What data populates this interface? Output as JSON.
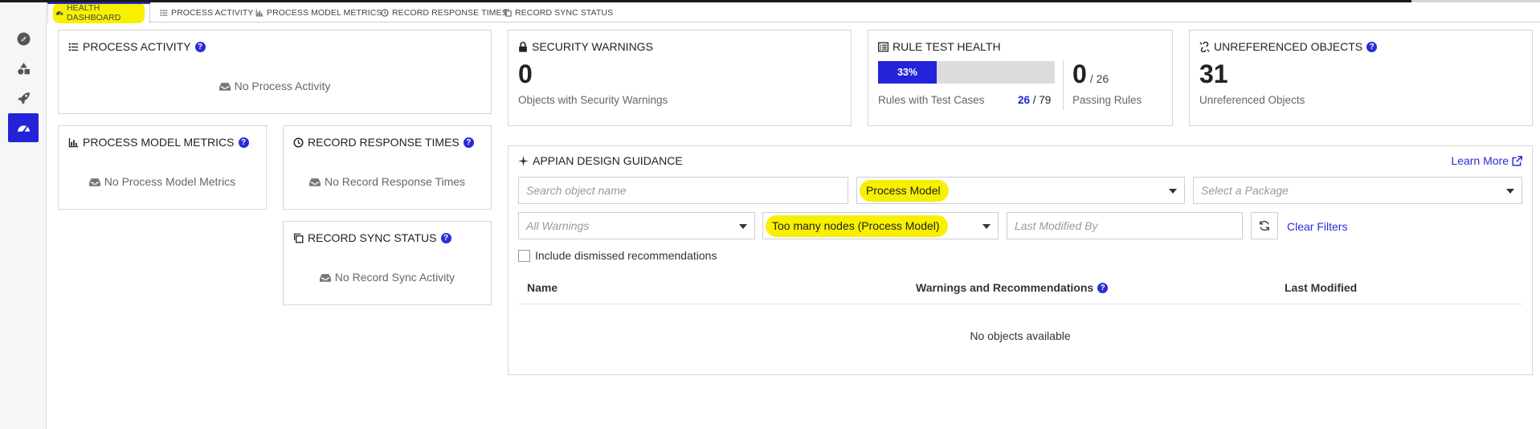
{
  "tabs": [
    {
      "label": "HEALTH DASHBOARD",
      "icon": "dashboard-icon"
    },
    {
      "label": "PROCESS ACTIVITY",
      "icon": "list-icon"
    },
    {
      "label": "PROCESS MODEL METRICS",
      "icon": "bar-chart-icon"
    },
    {
      "label": "RECORD RESPONSE TIMES",
      "icon": "clock-icon"
    },
    {
      "label": "RECORD SYNC STATUS",
      "icon": "copy-icon"
    }
  ],
  "sidebar": {
    "items": [
      {
        "icon": "compass-icon"
      },
      {
        "icon": "shapes-icon"
      },
      {
        "icon": "rocket-icon"
      },
      {
        "icon": "dashboard-icon",
        "active": true
      }
    ]
  },
  "process_activity": {
    "title": "PROCESS ACTIVITY",
    "empty": "No Process Activity"
  },
  "process_model_metrics": {
    "title": "PROCESS MODEL METRICS",
    "empty": "No Process Model Metrics"
  },
  "record_response_times": {
    "title": "RECORD RESPONSE TIMES",
    "empty": "No Record Response Times"
  },
  "record_sync_status": {
    "title": "RECORD SYNC STATUS",
    "empty": "No Record Sync Activity"
  },
  "security_warnings": {
    "title": "SECURITY WARNINGS",
    "count": "0",
    "label": "Objects with Security Warnings"
  },
  "rule_test_health": {
    "title": "RULE TEST HEALTH",
    "percent_label": "33%",
    "percent_value": 0.33,
    "rules_label": "Rules with Test Cases",
    "rules_tested": "26",
    "rules_total": "/ 79",
    "passing_count": "0",
    "passing_total": "/ 26",
    "passing_label": "Passing Rules"
  },
  "unreferenced_objects": {
    "title": "UNREFERENCED OBJECTS",
    "count": "31",
    "label": "Unreferenced Objects"
  },
  "design_guidance": {
    "title": "APPIAN DESIGN GUIDANCE",
    "learn_more": "Learn More",
    "search_placeholder": "Search object name",
    "object_type_value": "Process Model",
    "package_placeholder": "Select a Package",
    "warnings_placeholder": "All Warnings",
    "recommendation_value": "Too many nodes (Process Model)",
    "modified_by_placeholder": "Last Modified By",
    "clear_filters": "Clear Filters",
    "include_dismissed": "Include dismissed recommendations",
    "columns": [
      "Name",
      "Warnings and Recommendations",
      "Last Modified"
    ],
    "empty": "No objects available"
  },
  "colors": {
    "accent": "#2323d8",
    "highlight": "#f7f000"
  }
}
